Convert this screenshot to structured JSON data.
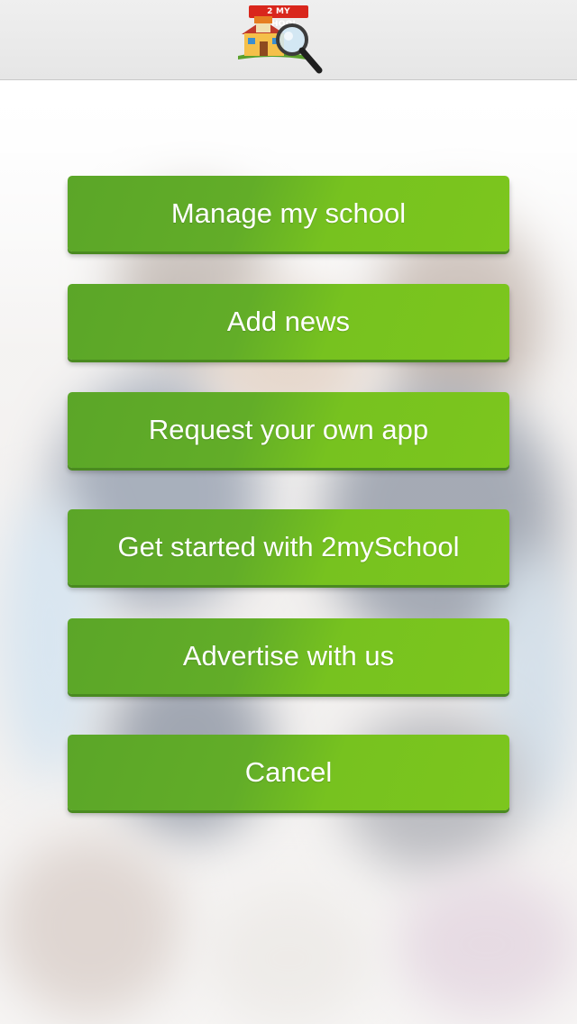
{
  "header": {
    "logo_text": "2 MY SCHOOL"
  },
  "menu": {
    "items": [
      {
        "label": "Manage my school"
      },
      {
        "label": "Add news"
      },
      {
        "label": "Request your own app"
      },
      {
        "label": "Get started with 2mySchool"
      },
      {
        "label": "Advertise with us"
      },
      {
        "label": "Cancel"
      }
    ]
  },
  "colors": {
    "button_green_dark": "#5ba628",
    "button_green_light": "#7cc61e",
    "header_bg": "#ebebeb",
    "logo_red": "#d9261c"
  }
}
